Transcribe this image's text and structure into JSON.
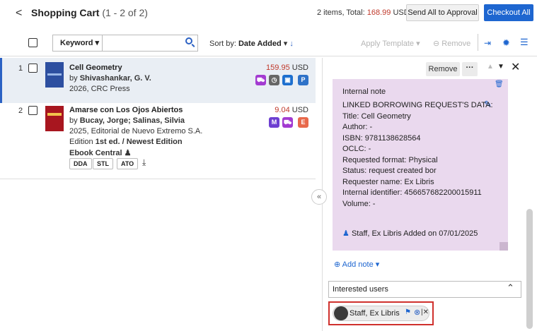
{
  "header": {
    "back": "<",
    "title": "Shopping Cart",
    "range": "(1 - 2 of 2)",
    "totals_prefix": "2 items, Total: ",
    "totals_value": "168.99",
    "totals_currency": "USD",
    "send_all": "Send All to Approval",
    "checkout_all": "Checkout All"
  },
  "toolbar": {
    "keyword": "Keyword",
    "sort_by": "Sort by:",
    "sort_value": "Date Added",
    "apply_template": "Apply Template",
    "remove": "Remove"
  },
  "items": [
    {
      "num": "1",
      "title": "Cell Geometry",
      "by": "by ",
      "authors": "Shivashankar, G. V.",
      "year_pub": "2026, CRC Press",
      "price": "159.95",
      "currency": "USD",
      "badges": [
        "cart",
        "clock",
        "store",
        "P"
      ]
    },
    {
      "num": "2",
      "title": "Amarse con Los Ojos Abiertos",
      "by": "by ",
      "authors": "Bucay, Jorge; Salinas, Silvia",
      "year_pub": "2025, Editorial de Nuevo Extremo S.A.",
      "edition_prefix": "Edition ",
      "edition": "1st ed. / Newest Edition",
      "platform": "Ebook Central",
      "tags": [
        "DDA",
        "STL",
        "ATO"
      ],
      "price": "9.04",
      "currency": "USD",
      "badges": [
        "M",
        "cart",
        "E"
      ]
    }
  ],
  "panel": {
    "remove": "Remove",
    "more": "···",
    "note": {
      "heading": "Internal note",
      "lines": [
        "LINKED BORROWING REQUEST'S DATA:",
        "Title: Cell Geometry",
        "Author: -",
        "ISBN: 9781138628564",
        "OCLC: -",
        "Requested format: Physical",
        "Status: request created bor",
        "Requester name: Ex Libris",
        "Internal identifier: 456657682200015911",
        "Volume: -"
      ],
      "author": "Staff, Ex Libris",
      "added": "Added on 07/01/2025"
    },
    "add_note": "Add note",
    "interested_users": "Interested users",
    "chip_name": "Staff, Ex Libris"
  },
  "colors": {
    "accent": "#1e66d0",
    "price": "#c0392b",
    "note_bg": "#ead9ee",
    "highlight": "#d0312d"
  }
}
